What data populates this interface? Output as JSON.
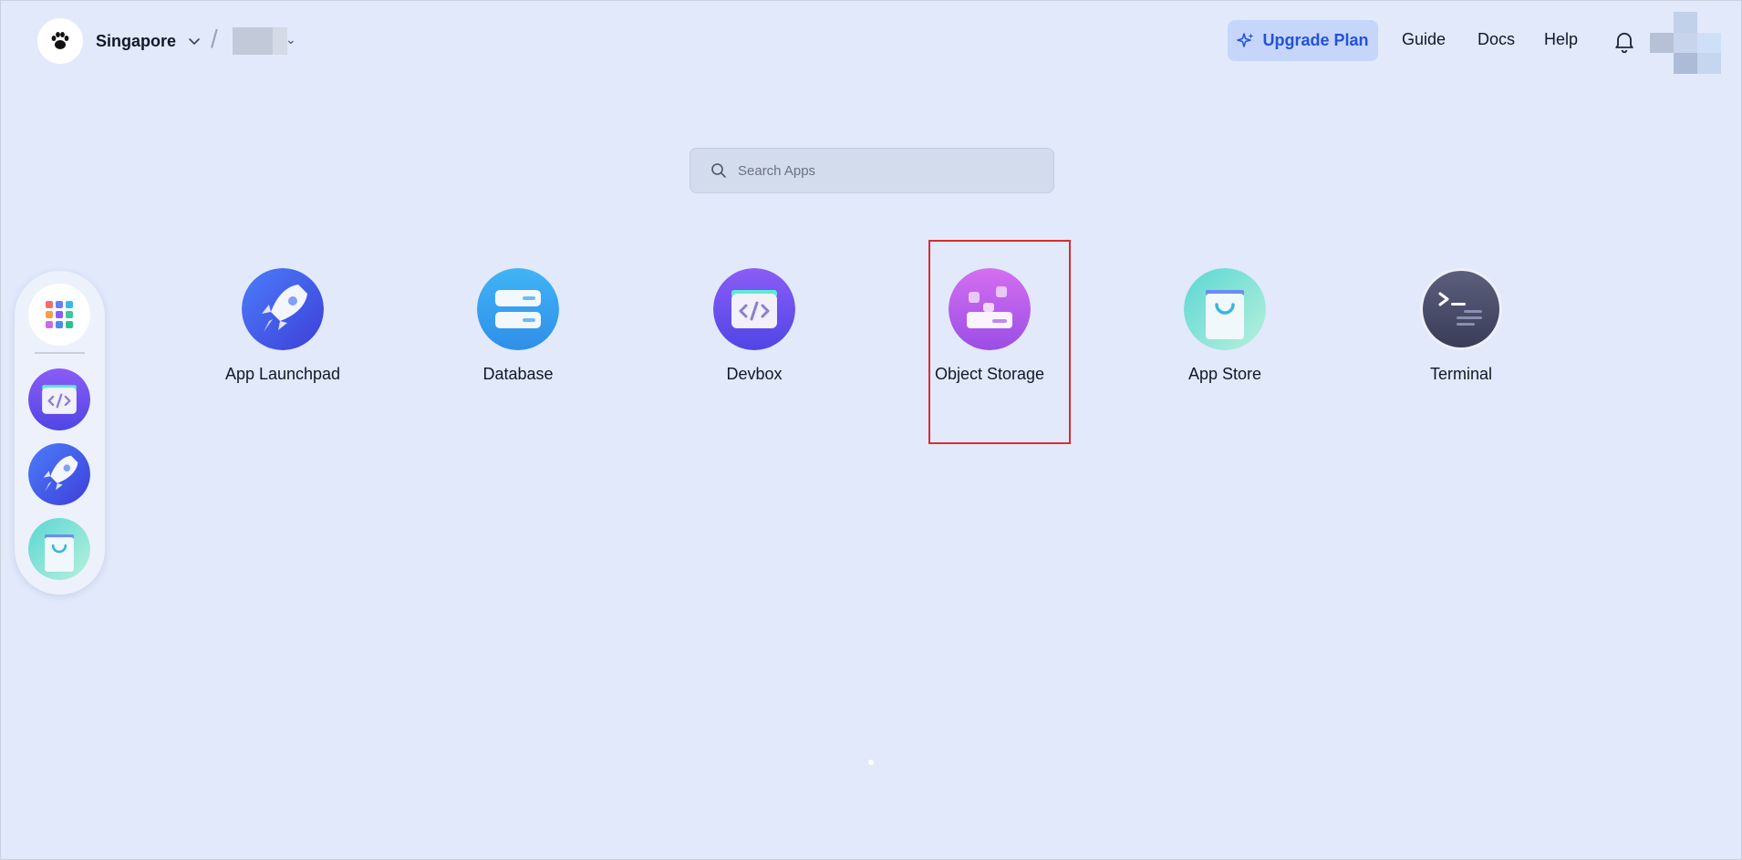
{
  "header": {
    "region": "Singapore",
    "upgrade_label": "Upgrade Plan",
    "nav": [
      "Guide",
      "Docs",
      "Help"
    ]
  },
  "search": {
    "placeholder": "Search Apps",
    "value": ""
  },
  "apps": [
    {
      "label": "App Launchpad",
      "icon": "rocket-icon"
    },
    {
      "label": "Database",
      "icon": "database-icon"
    },
    {
      "label": "Devbox",
      "icon": "code-window-icon"
    },
    {
      "label": "Object Storage",
      "icon": "object-storage-icon"
    },
    {
      "label": "App Store",
      "icon": "shopping-bag-icon"
    },
    {
      "label": "Terminal",
      "icon": "terminal-icon"
    }
  ],
  "dock": [
    "grid-apps-icon",
    "code-window-icon",
    "rocket-icon",
    "shopping-bag-icon"
  ],
  "colors": {
    "background": "#e1e9fb",
    "accent": "#2352d6",
    "highlight": "#d62e2e"
  }
}
